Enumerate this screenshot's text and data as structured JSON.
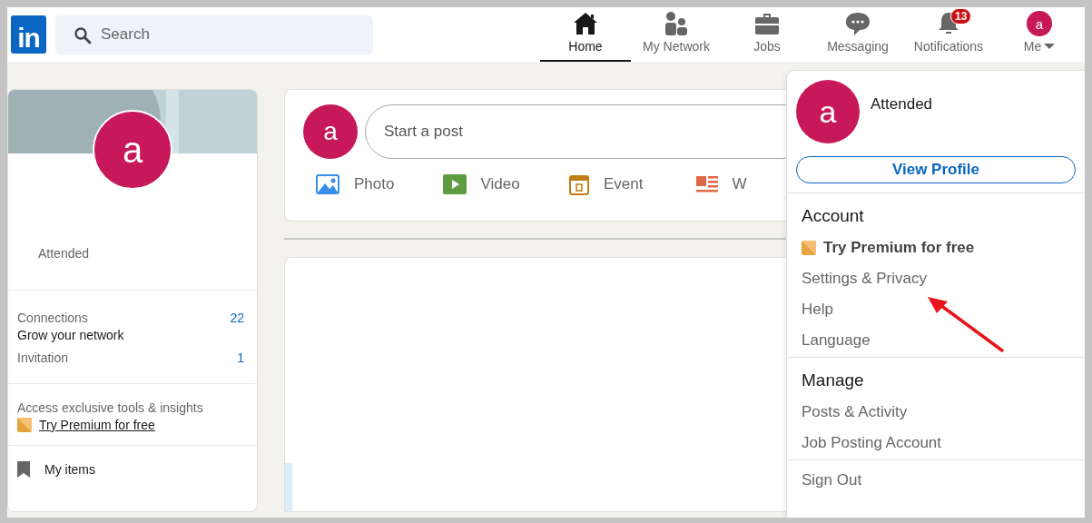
{
  "logo": "in",
  "search": {
    "placeholder": "Search"
  },
  "nav": [
    {
      "kind": "home",
      "label": "Home",
      "selected": true
    },
    {
      "kind": "network",
      "label": "My Network",
      "selected": false
    },
    {
      "kind": "jobs",
      "label": "Jobs",
      "selected": false
    },
    {
      "kind": "messaging",
      "label": "Messaging",
      "selected": false
    },
    {
      "kind": "bell",
      "label": "Notifications",
      "selected": false,
      "badge": "13"
    },
    {
      "kind": "avatar",
      "label": "Me",
      "selected": false,
      "avatar": "a"
    }
  ],
  "profile_card": {
    "avatar": "a",
    "subtitle": "Attended",
    "stats": [
      {
        "label": "Connections",
        "sub": "Grow your network",
        "value": "22"
      },
      {
        "label": "Invitation",
        "value": "1"
      }
    ],
    "premium_note": "Access exclusive tools & insights",
    "premium_link": "Try Premium for free",
    "my_items": "My items"
  },
  "composer": {
    "avatar": "a",
    "placeholder": "Start a post",
    "actions": [
      {
        "label": "Photo"
      },
      {
        "kind": "video",
        "label": "Video"
      },
      {
        "kind": "event",
        "label": "Event"
      },
      {
        "kind": "article",
        "label": "W"
      }
    ]
  },
  "me_menu": {
    "avatar": "a",
    "subtitle": "Attended",
    "view_profile": "View Profile",
    "sections": [
      {
        "title": "Account",
        "items": [
          {
            "label": "Try Premium for free",
            "premium": true
          },
          {
            "label": "Settings & Privacy",
            "premium": false
          },
          {
            "label": "Help",
            "premium": false
          },
          {
            "label": "Language",
            "premium": false
          }
        ]
      },
      {
        "title": "Manage",
        "items": [
          {
            "label": "Posts & Activity",
            "premium": false
          },
          {
            "label": "Job Posting Account",
            "premium": false
          }
        ]
      }
    ],
    "sign_out": "Sign Out"
  }
}
